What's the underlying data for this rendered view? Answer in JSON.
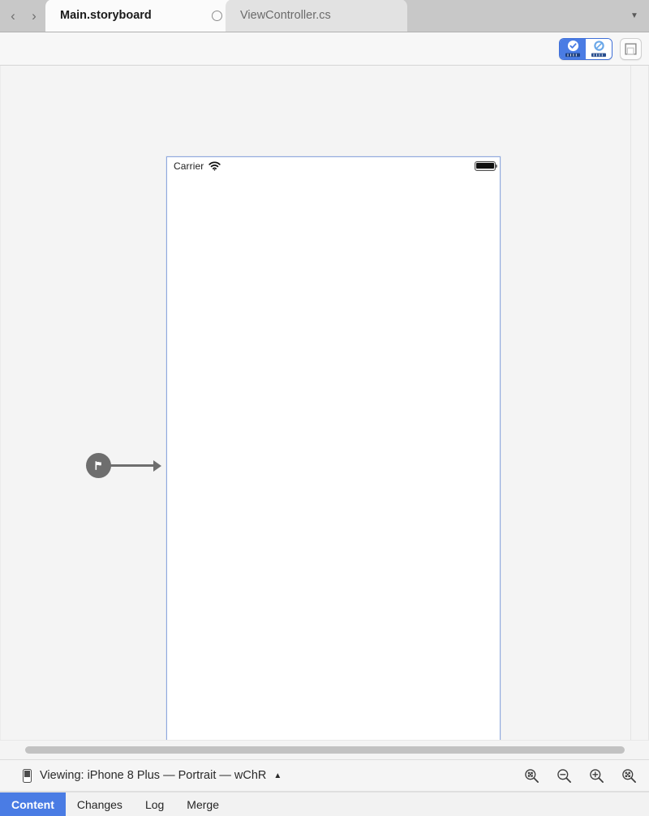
{
  "window": {
    "tabs": [
      {
        "label": "Main.storyboard",
        "active": true,
        "has_close": true,
        "close_icon": "circle-close-icon"
      },
      {
        "label": "ViewController.cs",
        "active": false,
        "has_close": false
      }
    ],
    "nav_back_icon": "chevron-left-icon",
    "nav_forward_icon": "chevron-right-icon",
    "tab_overflow_icon": "chevron-down-icon"
  },
  "toolbar": {
    "segmented": [
      {
        "name": "constraints-valid-button",
        "icon": "check-badge-ruler-icon",
        "selected": true,
        "accent": "#4a7ce4"
      },
      {
        "name": "constraints-disabled-button",
        "icon": "slash-badge-ruler-icon",
        "selected": false,
        "accent": "#6ca8e8"
      }
    ],
    "panel_toggle": {
      "name": "toggle-panel-button",
      "icon": "layout-panel-icon"
    }
  },
  "canvas": {
    "entry_point": {
      "icon": "flag-icon",
      "label": "storyboard-entry-point"
    },
    "device": {
      "status_bar": {
        "carrier": "Carrier",
        "wifi_icon": "wifi-icon",
        "battery_icon": "battery-full-icon"
      },
      "scene_dock": [
        {
          "name": "view-controller-icon",
          "icon": "view-controller-badge",
          "color": "#e8b33a"
        },
        {
          "name": "exit-icon",
          "icon": "exit-badge",
          "color": "#6fbf73"
        }
      ]
    }
  },
  "status": {
    "device_icon": "iphone-icon",
    "viewing_text": "Viewing: iPhone 8 Plus — Portrait — wChR",
    "expand_icon": "triangle-up-icon",
    "zoom_tools": [
      {
        "name": "zoom-to-fit-button",
        "icon": "magnifier-fit-icon"
      },
      {
        "name": "zoom-out-button",
        "icon": "magnifier-minus-icon"
      },
      {
        "name": "zoom-in-button",
        "icon": "magnifier-plus-icon"
      },
      {
        "name": "zoom-actual-size-button",
        "icon": "magnifier-expand-icon"
      }
    ]
  },
  "bottom_tabs": {
    "accent": "#4a7ce4",
    "items": [
      {
        "label": "Content",
        "active": true
      },
      {
        "label": "Changes",
        "active": false
      },
      {
        "label": "Log",
        "active": false
      },
      {
        "label": "Merge",
        "active": false
      }
    ]
  }
}
